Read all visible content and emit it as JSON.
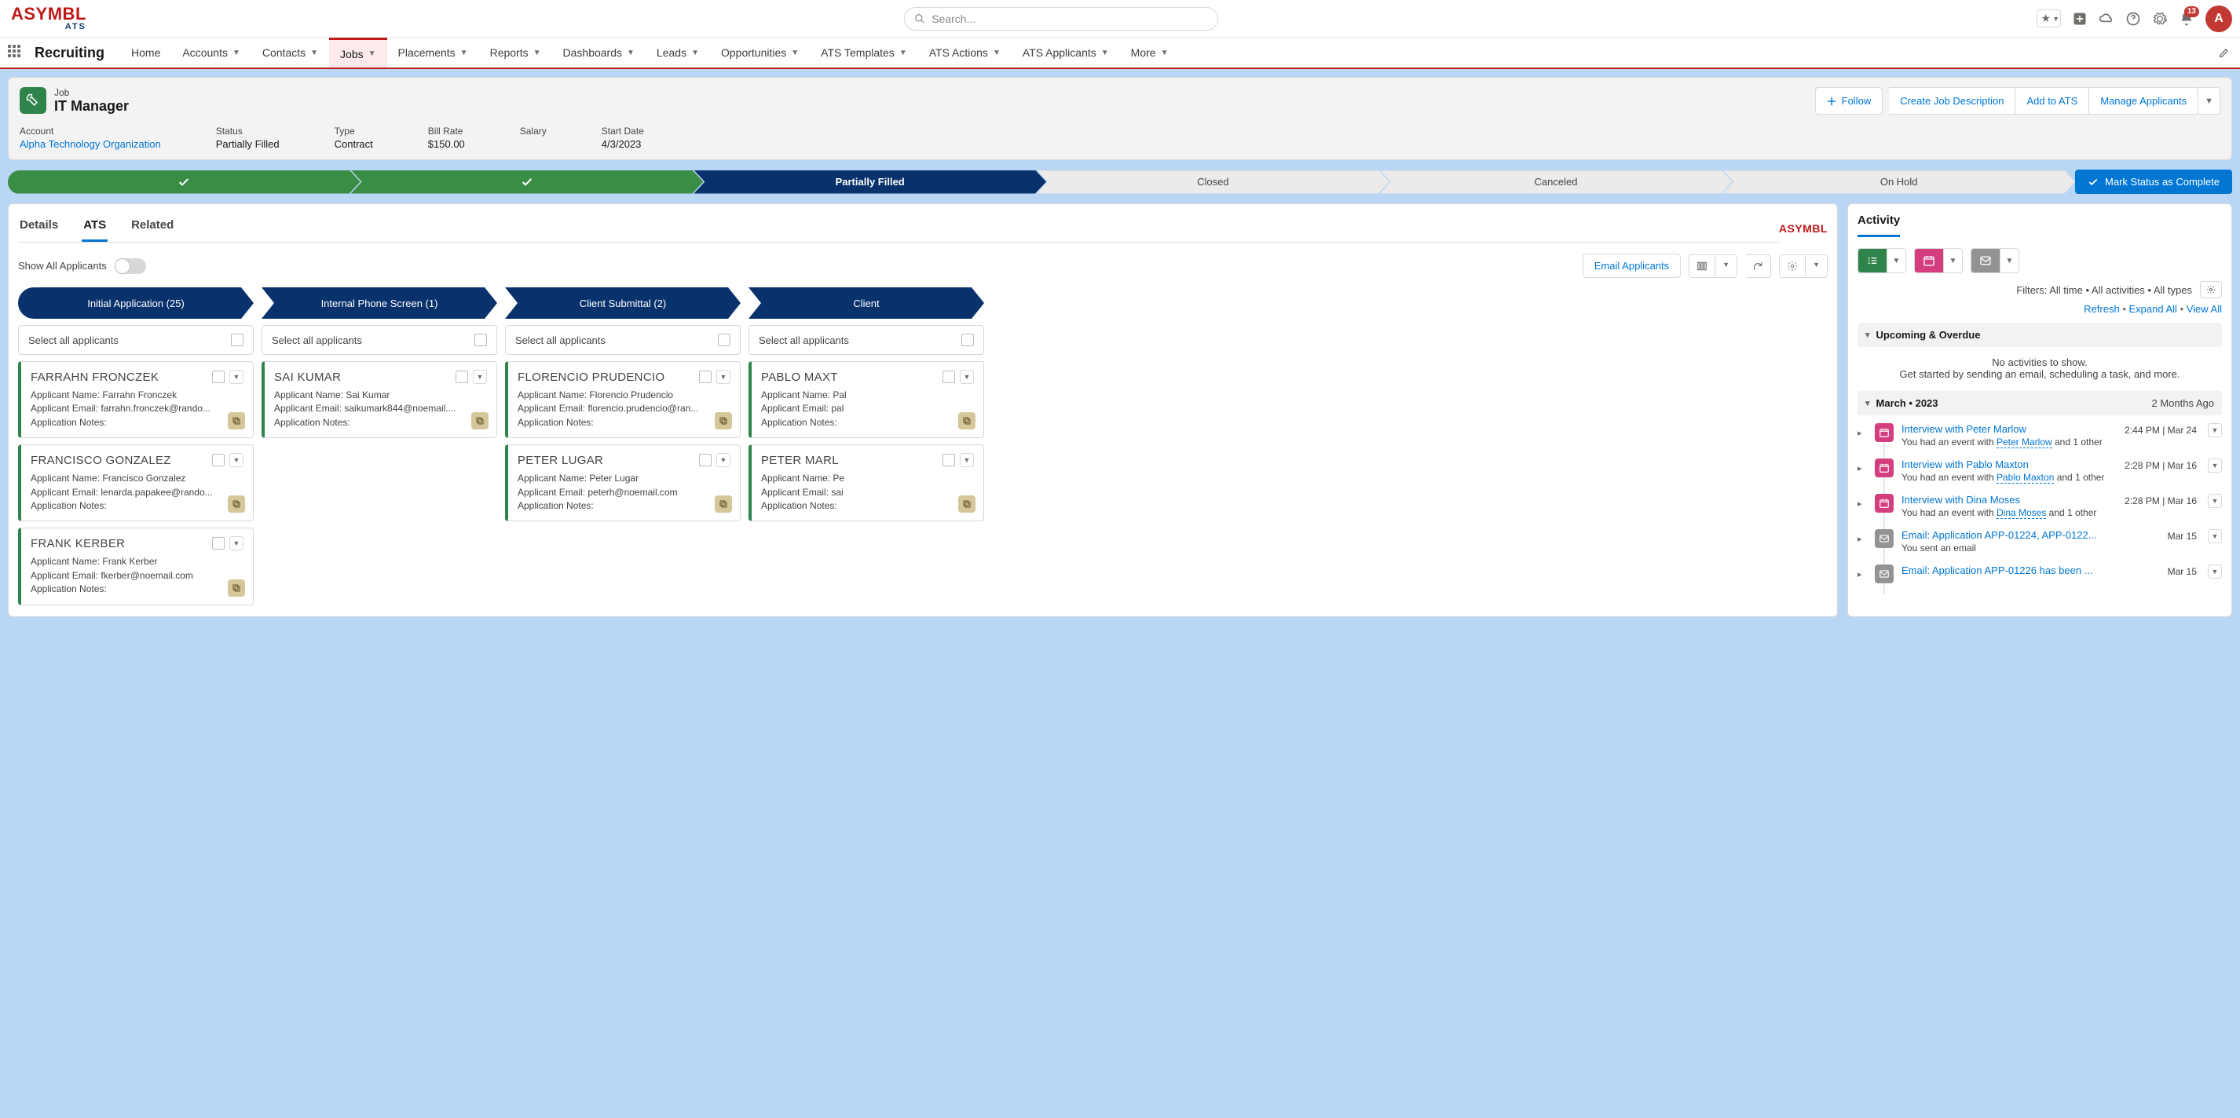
{
  "brand": {
    "main": "ASYMBL",
    "sub": "ATS"
  },
  "search": {
    "placeholder": "Search..."
  },
  "notif_count": "13",
  "avatar_initial": "A",
  "app_name": "Recruiting",
  "nav": [
    {
      "label": "Home",
      "chev": false
    },
    {
      "label": "Accounts",
      "chev": true
    },
    {
      "label": "Contacts",
      "chev": true
    },
    {
      "label": "Jobs",
      "chev": true,
      "active": true
    },
    {
      "label": "Placements",
      "chev": true
    },
    {
      "label": "Reports",
      "chev": true
    },
    {
      "label": "Dashboards",
      "chev": true
    },
    {
      "label": "Leads",
      "chev": true
    },
    {
      "label": "Opportunities",
      "chev": true
    },
    {
      "label": "ATS Templates",
      "chev": true
    },
    {
      "label": "ATS Actions",
      "chev": true
    },
    {
      "label": "ATS Applicants",
      "chev": true
    },
    {
      "label": "More",
      "chev": true
    }
  ],
  "record": {
    "obj_type": "Job",
    "title": "IT Manager",
    "follow": "Follow",
    "actions": [
      "Create Job Description",
      "Add to ATS",
      "Manage Applicants"
    ],
    "fields": [
      {
        "lbl": "Account",
        "val": "Alpha Technology Organization",
        "link": true
      },
      {
        "lbl": "Status",
        "val": "Partially Filled"
      },
      {
        "lbl": "Type",
        "val": "Contract"
      },
      {
        "lbl": "Bill Rate",
        "val": "$150.00"
      },
      {
        "lbl": "Salary",
        "val": ""
      },
      {
        "lbl": "Start Date",
        "val": "4/3/2023"
      }
    ]
  },
  "path": {
    "steps": [
      {
        "label": "",
        "state": "done",
        "check": true
      },
      {
        "label": "",
        "state": "done",
        "check": true
      },
      {
        "label": "Partially Filled",
        "state": "current"
      },
      {
        "label": "Closed",
        "state": "future"
      },
      {
        "label": "Canceled",
        "state": "future"
      },
      {
        "label": "On Hold",
        "state": "future"
      }
    ],
    "mark_complete": "Mark Status as Complete"
  },
  "tabs": {
    "details": "Details",
    "ats": "ATS",
    "related": "Related"
  },
  "toolbar": {
    "show_all": "Show All Applicants",
    "email_btn": "Email Applicants"
  },
  "lanes": [
    {
      "title": "Initial Application (25)",
      "select_all": "Select all applicants",
      "cards": [
        {
          "name": "FARRAHN FRONCZEK",
          "l1": "Applicant Name: Farrahn Fronczek",
          "l2": "Applicant Email: farrahn.fronczek@rando...",
          "l3": "Application Notes:"
        },
        {
          "name": "FRANCISCO GONZALEZ",
          "l1": "Applicant Name: Francisco Gonzalez",
          "l2": "Applicant Email: lenarda.papakee@rando...",
          "l3": "Application Notes:"
        },
        {
          "name": "FRANK KERBER",
          "l1": "Applicant Name: Frank Kerber",
          "l2": "Applicant Email: fkerber@noemail.com",
          "l3": "Application Notes:"
        }
      ]
    },
    {
      "title": "Internal Phone Screen (1)",
      "select_all": "Select all applicants",
      "cards": [
        {
          "name": "SAI KUMAR",
          "l1": "Applicant Name: Sai Kumar",
          "l2": "Applicant Email: saikumark844@noemail....",
          "l3": "Application Notes:"
        }
      ]
    },
    {
      "title": "Client Submittal (2)",
      "select_all": "Select all applicants",
      "cards": [
        {
          "name": "FLORENCIO PRUDENCIO",
          "l1": "Applicant Name: Florencio Prudencio",
          "l2": "Applicant Email: florencio.prudencio@ran...",
          "l3": "Application Notes:"
        },
        {
          "name": "PETER LUGAR",
          "l1": "Applicant Name: Peter Lugar",
          "l2": "Applicant Email: peterh@noemail.com",
          "l3": "Application Notes:"
        }
      ]
    },
    {
      "title": "Client",
      "select_all": "Select all applicants",
      "cards": [
        {
          "name": "PABLO MAXT",
          "l1": "Applicant Name: Pal",
          "l2": "Applicant Email: pal",
          "l3": "Application Notes:"
        },
        {
          "name": "PETER MARL",
          "l1": "Applicant Name: Pe",
          "l2": "Applicant Email: sai",
          "l3": "Application Notes:"
        }
      ]
    }
  ],
  "activity": {
    "title": "Activity",
    "filters": "Filters: All time • All activities • All types",
    "refresh": "Refresh",
    "expand": "Expand All",
    "view_all": "View All",
    "upcoming": "Upcoming & Overdue",
    "empty1": "No activities to show.",
    "empty2": "Get started by sending an email, scheduling a task, and more.",
    "month_hdr": "March  •  2023",
    "month_ago": "2 Months Ago",
    "items": [
      {
        "type": "ev",
        "title": "Interview with Peter Marlow",
        "sub_pre": "You had an event with ",
        "sub_link": "Peter Marlow",
        "sub_post": " and 1 other",
        "time": "2:44 PM | Mar 24"
      },
      {
        "type": "ev",
        "title": "Interview with Pablo Maxton",
        "sub_pre": "You had an event with ",
        "sub_link": "Pablo Maxton",
        "sub_post": " and 1 other",
        "time": "2:28 PM | Mar 16"
      },
      {
        "type": "ev",
        "title": "Interview with Dina Moses",
        "sub_pre": "You had an event with ",
        "sub_link": "Dina Moses",
        "sub_post": " and 1 other",
        "time": "2:28 PM | Mar 16"
      },
      {
        "type": "em",
        "title": "Email: Application APP-01224, APP-0122...",
        "sub_pre": "You sent an email",
        "sub_link": "",
        "sub_post": "",
        "time": "Mar 15"
      },
      {
        "type": "em",
        "title": "Email: Application APP-01226 has been ...",
        "sub_pre": "",
        "sub_link": "",
        "sub_post": "",
        "time": "Mar 15"
      }
    ]
  }
}
